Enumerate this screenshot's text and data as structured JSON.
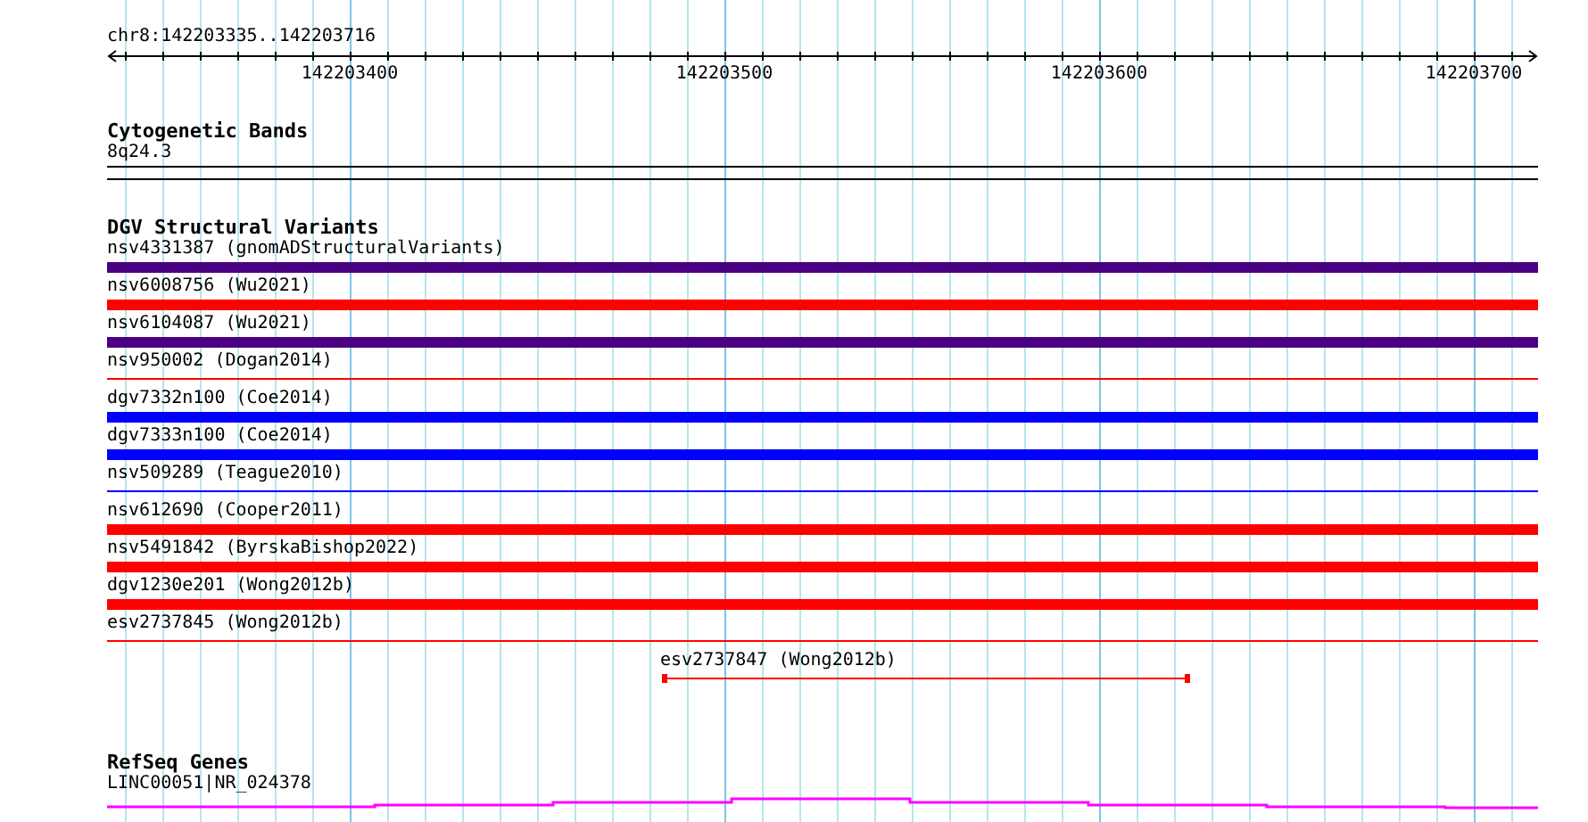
{
  "ruler": {
    "region": "chr8:142203335..142203716",
    "tick_labels": [
      "142203400",
      "142203500",
      "142203600",
      "142203700"
    ]
  },
  "cytogenetic_bands": {
    "title": "Cytogenetic Bands",
    "band": "8q24.3"
  },
  "dgv_structural_variants": {
    "title": "DGV Structural Variants",
    "variants": [
      {
        "label": "nsv4331387 (gnomADStructuralVariants)",
        "color": "#4b0082",
        "kind": "thick"
      },
      {
        "label": "nsv6008756 (Wu2021)",
        "color": "#ff0000",
        "kind": "thick"
      },
      {
        "label": "nsv6104087 (Wu2021)",
        "color": "#4b0082",
        "kind": "thick"
      },
      {
        "label": "nsv950002 (Dogan2014)",
        "color": "#ff0000",
        "kind": "thin"
      },
      {
        "label": "dgv7332n100 (Coe2014)",
        "color": "#0000ff",
        "kind": "thick"
      },
      {
        "label": "dgv7333n100 (Coe2014)",
        "color": "#0000ff",
        "kind": "thick"
      },
      {
        "label": "nsv509289 (Teague2010)",
        "color": "#0000ff",
        "kind": "thin"
      },
      {
        "label": "nsv612690 (Cooper2011)",
        "color": "#ff0000",
        "kind": "thick"
      },
      {
        "label": "nsv5491842 (ByrskaBishop2022)",
        "color": "#ff0000",
        "kind": "thick"
      },
      {
        "label": "dgv1230e201 (Wong2012b)",
        "color": "#ff0000",
        "kind": "thick"
      },
      {
        "label": "esv2737845 (Wong2012b)",
        "color": "#ff0000",
        "kind": "thin"
      },
      {
        "label": "esv2737847 (Wong2012b)",
        "color": "#ff0000",
        "kind": "span"
      }
    ]
  },
  "refseq_genes": {
    "title": "RefSeq Genes",
    "gene": "LINC00051|NR_024378"
  }
}
